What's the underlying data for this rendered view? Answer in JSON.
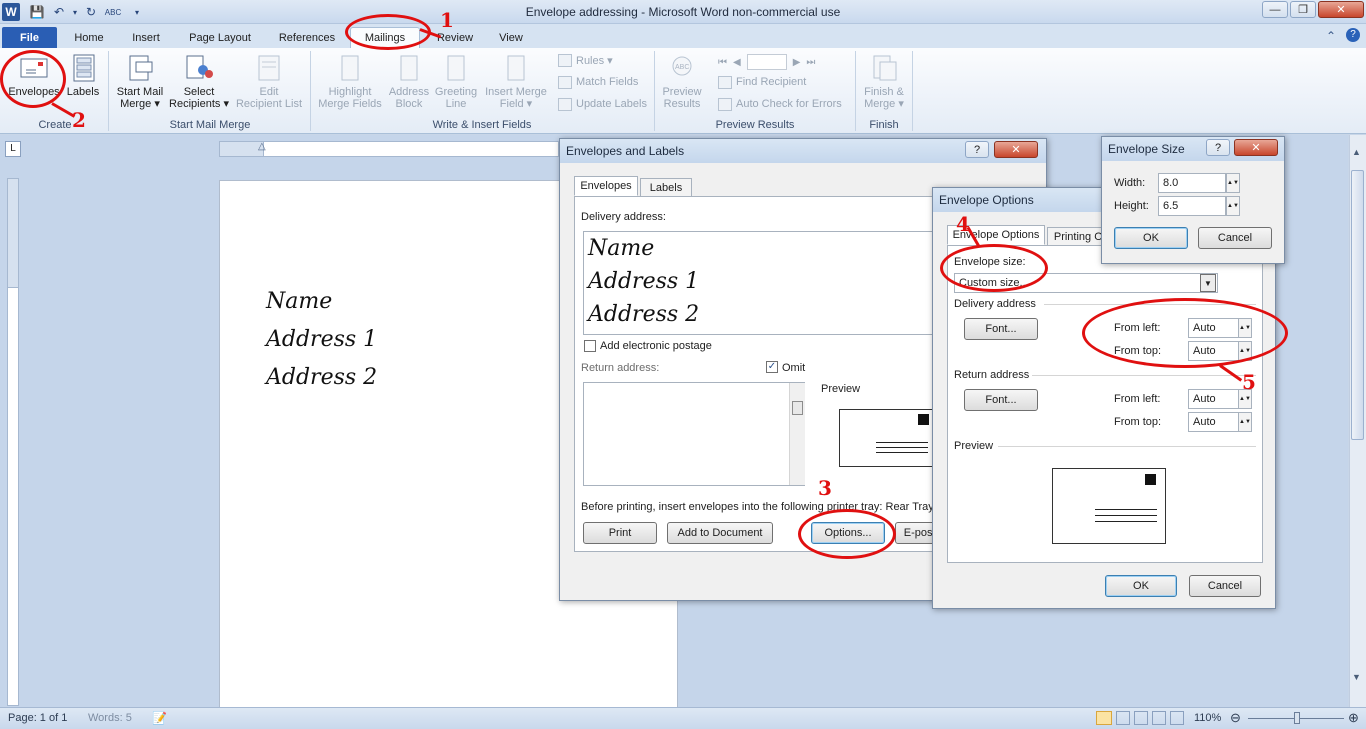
{
  "window": {
    "title": "Envelope addressing  -  Microsoft Word non-commercial use"
  },
  "ribbon": {
    "tabs": [
      "File",
      "Home",
      "Insert",
      "Page Layout",
      "References",
      "Mailings",
      "Review",
      "View"
    ],
    "groups": {
      "create": {
        "label": "Create",
        "envelopes": "Envelopes",
        "labels": "Labels"
      },
      "start_mail_merge": {
        "label": "Start Mail Merge",
        "start": "Start Mail\nMerge ▾",
        "select": "Select\nRecipients ▾",
        "edit": "Edit\nRecipient List"
      },
      "write_insert": {
        "label": "Write & Insert Fields",
        "highlight": "Highlight\nMerge Fields",
        "address_block": "Address\nBlock",
        "greeting": "Greeting\nLine",
        "insert_merge": "Insert Merge\nField ▾",
        "rules": "Rules ▾",
        "match": "Match Fields",
        "update": "Update Labels"
      },
      "preview": {
        "label": "Preview Results",
        "preview_btn": "Preview\nResults",
        "find": "Find Recipient",
        "auto_check": "Auto Check for Errors"
      },
      "finish": {
        "label": "Finish",
        "finish_btn": "Finish &\nMerge ▾"
      }
    }
  },
  "document": {
    "lines": [
      "Name",
      "Address 1",
      "Address 2"
    ]
  },
  "status": {
    "page": "Page: 1 of 1",
    "words": "Words: 5",
    "zoom": "110%"
  },
  "env_labels": {
    "title": "Envelopes and Labels",
    "tabs": [
      "Envelopes",
      "Labels"
    ],
    "delivery_label": "Delivery address:",
    "delivery_lines": [
      "Name",
      "Address 1",
      "Address 2"
    ],
    "add_postage": "Add electronic postage",
    "return_label": "Return address:",
    "omit": "Omit",
    "preview_label": "Preview",
    "tray_text": "Before printing, insert envelopes into the following printer tray: Rear Tray",
    "buttons": {
      "print": "Print",
      "add_doc": "Add to Document",
      "options": "Options...",
      "epostage": "E-postage Properties..."
    }
  },
  "env_options": {
    "title": "Envelope Options",
    "tabs": [
      "Envelope Options",
      "Printing Options"
    ],
    "size_label": "Envelope size:",
    "size_value": "Custom size...",
    "delivery_label": "Delivery address",
    "font_btn": "Font...",
    "from_left": "From left:",
    "from_top": "From top:",
    "delivery_left": "Auto",
    "delivery_top": "Auto",
    "return_label": "Return address",
    "return_left": "Auto",
    "return_top": "Auto",
    "preview_label": "Preview",
    "ok": "OK",
    "cancel": "Cancel"
  },
  "env_size": {
    "title": "Envelope Size",
    "width_label": "Width:",
    "width_value": "8.0",
    "height_label": "Height:",
    "height_value": "6.5",
    "ok": "OK",
    "cancel": "Cancel"
  },
  "annotations": [
    "1",
    "2",
    "3",
    "4",
    "5"
  ]
}
